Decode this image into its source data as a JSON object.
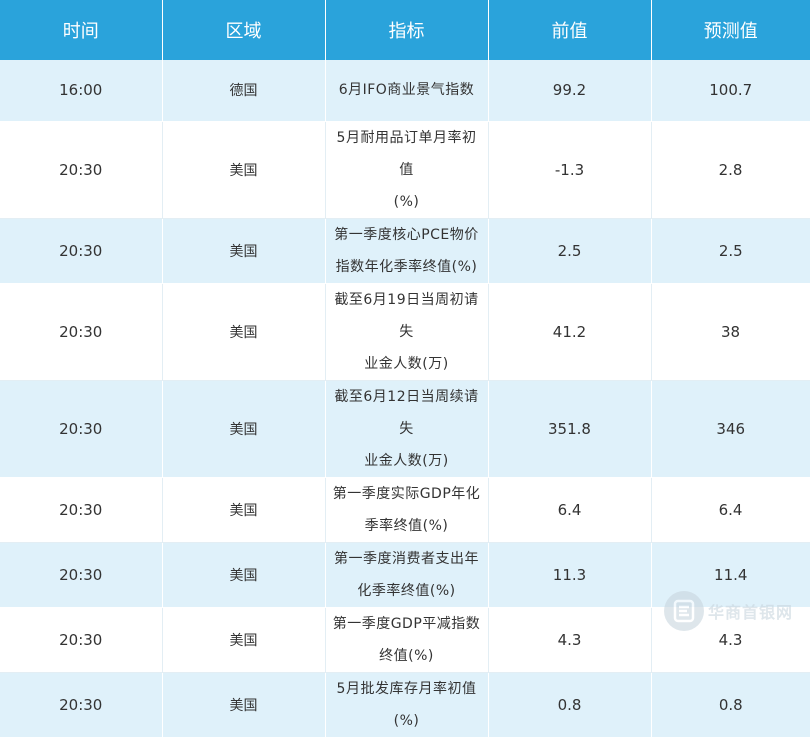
{
  "table": {
    "headers": {
      "time": "时间",
      "region": "区域",
      "indicator": "指标",
      "previous": "前值",
      "forecast": "预测值"
    },
    "rows": [
      {
        "time": "16:00",
        "region": "德国",
        "indicator_lines": [
          "6月IFO商业景气指数"
        ],
        "previous": "99.2",
        "forecast": "100.7"
      },
      {
        "time": "20:30",
        "region": "美国",
        "indicator_lines": [
          "5月耐用品订单月率初值",
          "(%)"
        ],
        "previous": "-1.3",
        "forecast": "2.8"
      },
      {
        "time": "20:30",
        "region": "美国",
        "indicator_lines": [
          "第一季度核心PCE物价",
          "指数年化季率终值(%)"
        ],
        "previous": "2.5",
        "forecast": "2.5"
      },
      {
        "time": "20:30",
        "region": "美国",
        "indicator_lines": [
          "截至6月19日当周初请失",
          "业金人数(万)"
        ],
        "previous": "41.2",
        "forecast": "38"
      },
      {
        "time": "20:30",
        "region": "美国",
        "indicator_lines": [
          "截至6月12日当周续请失",
          "业金人数(万)"
        ],
        "previous": "351.8",
        "forecast": "346"
      },
      {
        "time": "20:30",
        "region": "美国",
        "indicator_lines": [
          "第一季度实际GDP年化",
          "季率终值(%)"
        ],
        "previous": "6.4",
        "forecast": "6.4"
      },
      {
        "time": "20:30",
        "region": "美国",
        "indicator_lines": [
          "第一季度消费者支出年",
          "化季率终值(%)"
        ],
        "previous": "11.3",
        "forecast": "11.4"
      },
      {
        "time": "20:30",
        "region": "美国",
        "indicator_lines": [
          "第一季度GDP平减指数",
          "终值(%)"
        ],
        "previous": "4.3",
        "forecast": "4.3"
      },
      {
        "time": "20:30",
        "region": "美国",
        "indicator_lines": [
          "5月批发库存月率初值",
          "(%)"
        ],
        "previous": "0.8",
        "forecast": "0.8"
      }
    ]
  },
  "watermark": {
    "text": "华商首银网",
    "icon": "e-circle-logo-icon"
  },
  "colors": {
    "header_bg": "#2aa3db",
    "header_text": "#ffffff",
    "row_alt_bg": "#dff1fa",
    "row_bg": "#ffffff",
    "cell_text": "#333333"
  }
}
